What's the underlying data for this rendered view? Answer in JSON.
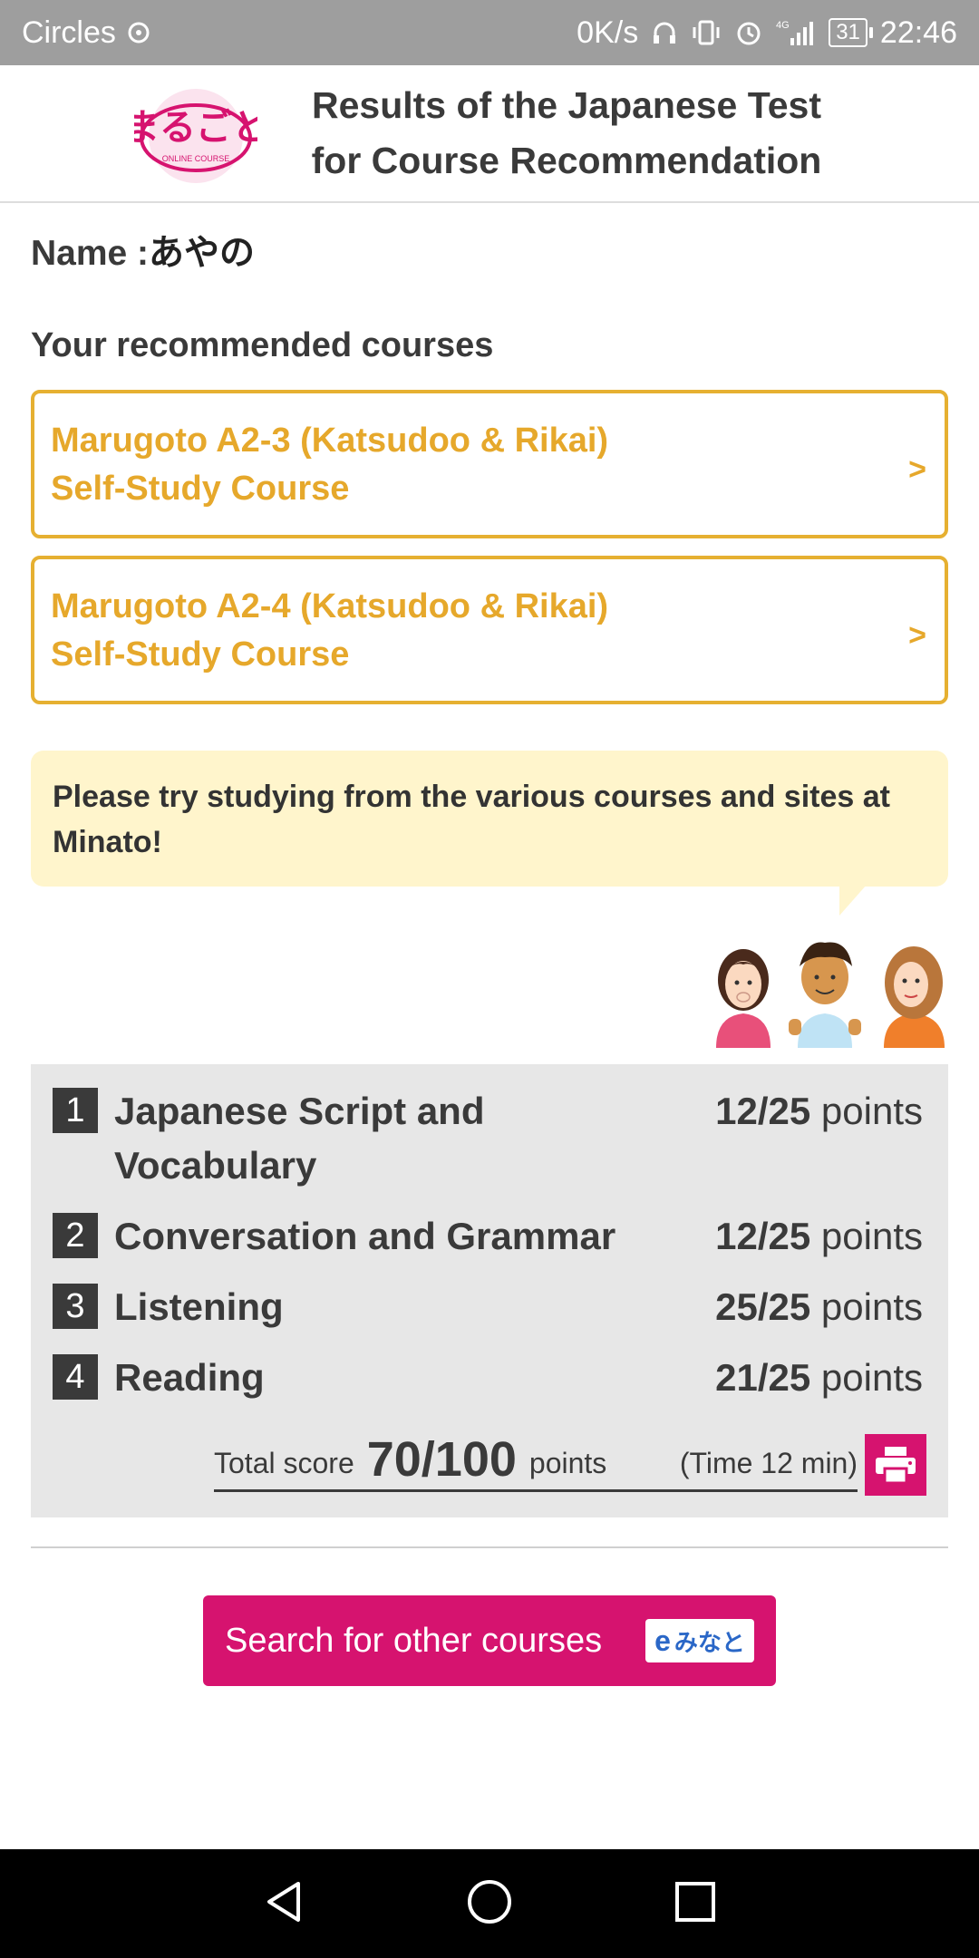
{
  "status_bar": {
    "carrier": "Circles",
    "speed": "0K/s",
    "battery": "31",
    "time": "22:46",
    "signal_label": "4G"
  },
  "header": {
    "logo_text": "まるごと",
    "logo_sub": "ONLINE COURSE",
    "title_line1": "Results of the Japanese Test",
    "title_line2": "for Course Recommendation"
  },
  "name": {
    "label": "Name :",
    "value": "あやの"
  },
  "recommended": {
    "title": "Your recommended courses",
    "courses": [
      {
        "line1": "Marugoto A2-3 (Katsudoo & Rikai)",
        "line2": "Self-Study Course",
        "chevron": ">"
      },
      {
        "line1": "Marugoto A2-4 (Katsudoo & Rikai)",
        "line2": "Self-Study Course",
        "chevron": ">"
      }
    ]
  },
  "bubble": {
    "text": "Please try studying from the various courses and sites at Minato!"
  },
  "scores": {
    "rows": [
      {
        "num": "1",
        "label": "Japanese Script and Vocabulary",
        "score": "12/25",
        "unit": "points"
      },
      {
        "num": "2",
        "label": "Conversation and Grammar",
        "score": "12/25",
        "unit": "points"
      },
      {
        "num": "3",
        "label": "Listening",
        "score": "25/25",
        "unit": "points"
      },
      {
        "num": "4",
        "label": "Reading",
        "score": "21/25",
        "unit": "points"
      }
    ],
    "total_label": "Total score",
    "total_value": "70/100",
    "total_unit": "points",
    "time": "(Time 12 min)"
  },
  "search_button": {
    "label": "Search for other courses",
    "badge_e": "e",
    "badge_text": "みなと"
  },
  "colors": {
    "accent_pink": "#d6136f",
    "course_gold": "#e6a82b",
    "bubble_bg": "#fff5cc",
    "score_bg": "#e7e7e7"
  }
}
